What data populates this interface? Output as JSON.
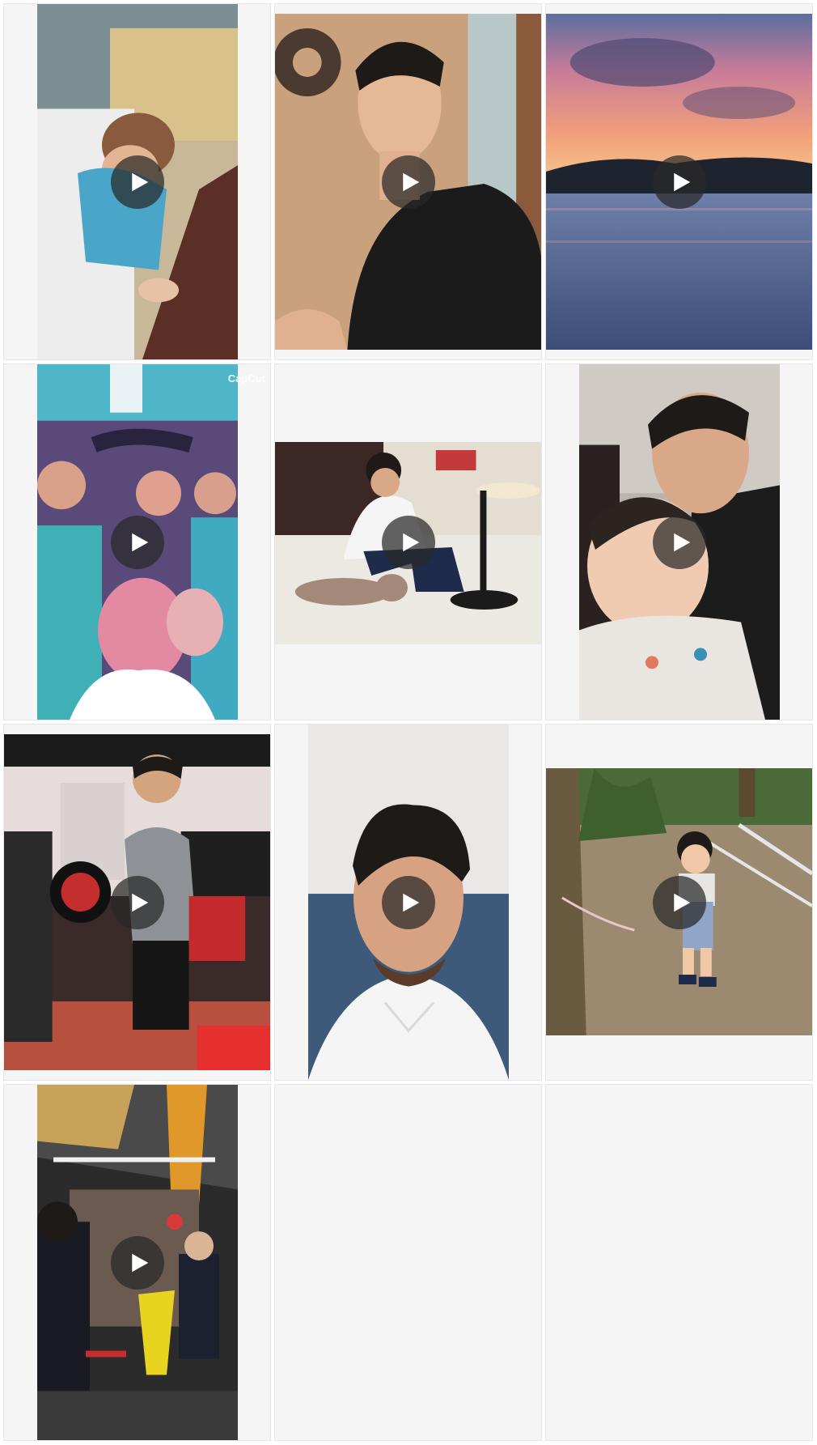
{
  "grid": {
    "items": [
      {
        "type": "video",
        "subject": "baby sleeping in high chair",
        "play_icon": "play-icon"
      },
      {
        "type": "video",
        "subject": "man in black t-shirt talking",
        "play_icon": "play-icon"
      },
      {
        "type": "video",
        "subject": "sunset over lake",
        "play_icon": "play-icon"
      },
      {
        "type": "video",
        "subject": "crowd selfie at party",
        "play_icon": "play-icon",
        "watermark": "CapCut"
      },
      {
        "type": "video",
        "subject": "man petting cat on floor",
        "play_icon": "play-icon"
      },
      {
        "type": "video",
        "subject": "man holding baby selfie",
        "play_icon": "play-icon"
      },
      {
        "type": "video",
        "subject": "man lifting dumbbell at gym",
        "play_icon": "play-icon"
      },
      {
        "type": "video",
        "subject": "man in white shirt selfie",
        "play_icon": "play-icon"
      },
      {
        "type": "video",
        "subject": "toddler standing in park",
        "play_icon": "play-icon"
      },
      {
        "type": "video",
        "subject": "night market street scene",
        "play_icon": "play-icon"
      },
      {
        "type": "empty"
      },
      {
        "type": "empty"
      }
    ]
  },
  "colors": {
    "cell_background": "#f5f5f6",
    "play_overlay": "#282828"
  }
}
